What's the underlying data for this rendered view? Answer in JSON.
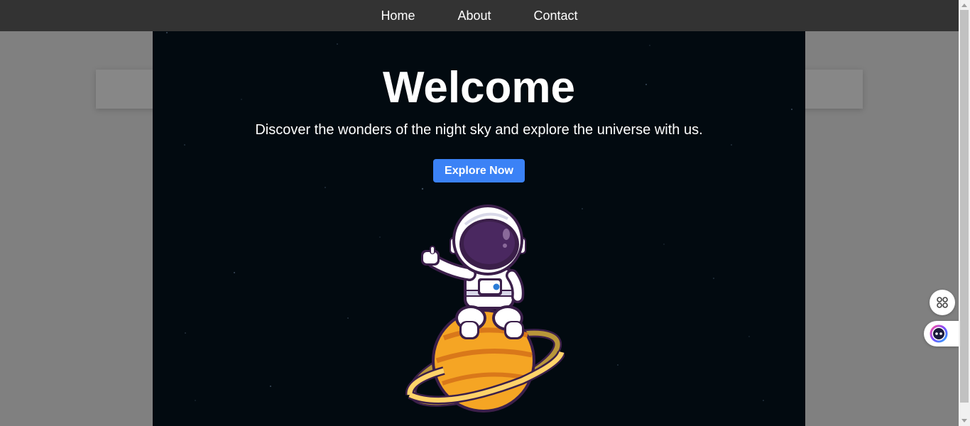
{
  "nav": {
    "items": [
      {
        "label": "Home"
      },
      {
        "label": "About"
      },
      {
        "label": "Contact"
      }
    ]
  },
  "hero": {
    "title": "Welcome",
    "subtitle": "Discover the wonders of the night sky and explore the universe with us.",
    "button_label": "Explore Now",
    "illustration": "astronaut-on-planet"
  },
  "widgets": {
    "apps_icon": "four-circles-grid-icon",
    "assistant_icon": "assistant-face-icon"
  },
  "colors": {
    "navbar": "#333333",
    "hero_background": "#020a10",
    "button": "#3b82f6",
    "page_overlay": "#808080",
    "planet": "#f5a524",
    "astronaut_visor": "#3b1f4a"
  }
}
